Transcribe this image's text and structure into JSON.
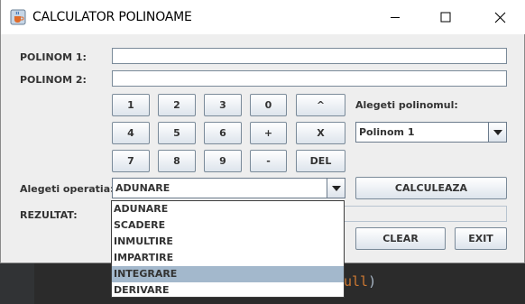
{
  "window": {
    "title": "CALCULATOR POLINOAME",
    "icons": {
      "app": "java-cup-icon",
      "minimize": "minimize-icon",
      "maximize": "maximize-icon",
      "close": "close-icon"
    }
  },
  "labels": {
    "polinom1": "POLINOM 1:",
    "polinom2": "POLINOM 2:",
    "alegeti_polinomul": "Alegeti polinomul:",
    "alegeti_operatia": "Alegeti operatia:",
    "rezultat": "REZULTAT:"
  },
  "inputs": {
    "polinom1_value": "",
    "polinom2_value": "",
    "rezultat_value": ""
  },
  "keypad": {
    "k1": "1",
    "k2": "2",
    "k3": "3",
    "k0": "0",
    "kpow": "^",
    "k4": "4",
    "k5": "5",
    "k6": "6",
    "kplus": "+",
    "kx": "X",
    "k7": "7",
    "k8": "8",
    "k9": "9",
    "kminus": "-",
    "kdel": "DEL"
  },
  "polinom_select": {
    "selected": "Polinom 1"
  },
  "operatie_select": {
    "selected": "ADUNARE",
    "options": [
      "ADUNARE",
      "SCADERE",
      "INMULTIRE",
      "IMPARTIRE",
      "INTEGRARE",
      "DERIVARE"
    ],
    "highlighted": "INTEGRARE"
  },
  "buttons": {
    "calculeaza": "CALCULEAZA",
    "clear": "CLEAR",
    "exit": "EXIT"
  },
  "background_code": {
    "line1": "",
    "line2_kw": "ull",
    "line2_paren": ")",
    "line3": ""
  },
  "colors": {
    "window_bg": "#eeeeee",
    "highlight": "#a3b8cc",
    "editor_bg": "#2b2b2b"
  }
}
